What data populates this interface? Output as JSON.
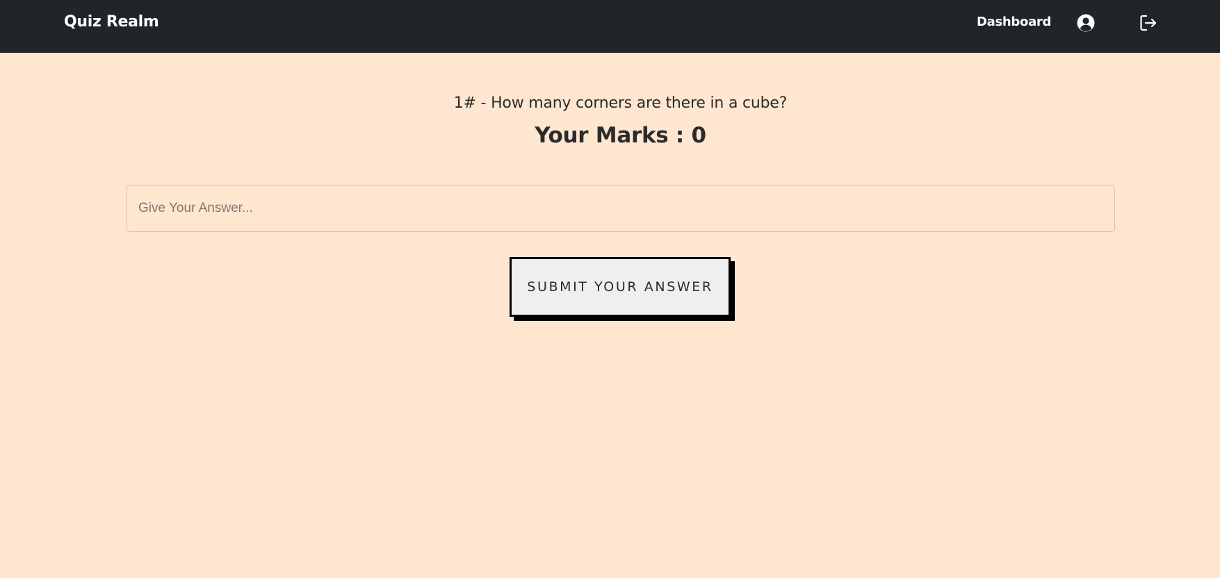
{
  "navbar": {
    "brand": "Quiz Realm",
    "links": {
      "dashboard": "Dashboard"
    },
    "icons": {
      "profile": "user-circle-icon",
      "logout": "logout-icon"
    },
    "background": "#212429"
  },
  "quiz": {
    "question": "1# - How many corners are there in a cube?",
    "marks": "Your Marks : 0",
    "answer_placeholder": "Give Your Answer...",
    "answer_value": "",
    "submit_label": "SUBMIT YOUR ANSWER"
  },
  "colors": {
    "page_background": "#ffe6d1",
    "button_background": "#efefef",
    "button_shadow": "#000000"
  }
}
